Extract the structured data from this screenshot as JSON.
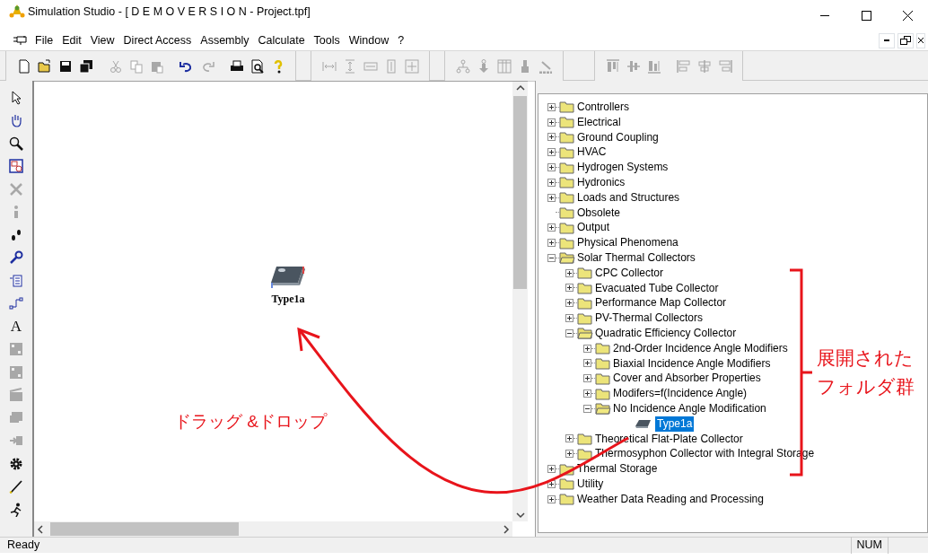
{
  "window": {
    "title": "Simulation Studio - [ D E M O V E R S I O N - Project.tpf]"
  },
  "menu": [
    "File",
    "Edit",
    "View",
    "Direct Access",
    "Assembly",
    "Calculate",
    "Tools",
    "Window",
    "?"
  ],
  "toolbar_groups": [
    [
      {
        "kind": "new",
        "disabled": false
      },
      {
        "kind": "open",
        "disabled": false
      },
      {
        "kind": "save",
        "disabled": false
      },
      {
        "kind": "save-all",
        "disabled": false
      },
      {
        "kind": "gap"
      },
      {
        "kind": "cut",
        "disabled": true
      },
      {
        "kind": "copy",
        "disabled": true
      },
      {
        "kind": "paste",
        "disabled": true
      },
      {
        "kind": "gap"
      },
      {
        "kind": "undo",
        "disabled": false
      },
      {
        "kind": "redo",
        "disabled": true
      },
      {
        "kind": "gap"
      },
      {
        "kind": "print",
        "disabled": false
      },
      {
        "kind": "preview",
        "disabled": false
      },
      {
        "kind": "help",
        "disabled": false
      }
    ],
    [
      {
        "kind": "space-h",
        "disabled": true
      },
      {
        "kind": "space-v",
        "disabled": true
      },
      {
        "kind": "width",
        "disabled": true
      },
      {
        "kind": "height",
        "disabled": true
      },
      {
        "kind": "size",
        "disabled": true
      }
    ],
    [
      {
        "kind": "tree",
        "disabled": true
      },
      {
        "kind": "down",
        "disabled": true
      },
      {
        "kind": "table",
        "disabled": true
      },
      {
        "kind": "brush",
        "disabled": true
      },
      {
        "kind": "wand",
        "disabled": true
      }
    ],
    [
      {
        "kind": "align-top",
        "disabled": true
      },
      {
        "kind": "align-middle",
        "disabled": true
      },
      {
        "kind": "align-bottom",
        "disabled": true
      },
      {
        "kind": "gap"
      },
      {
        "kind": "align-left",
        "disabled": true
      },
      {
        "kind": "align-center",
        "disabled": true
      },
      {
        "kind": "align-right",
        "disabled": true
      }
    ]
  ],
  "side_tools": [
    {
      "kind": "pointer",
      "disabled": false
    },
    {
      "kind": "hand",
      "disabled": false
    },
    {
      "kind": "zoom",
      "disabled": false
    },
    {
      "kind": "select",
      "disabled": false
    },
    {
      "kind": "delete",
      "disabled": true
    },
    {
      "kind": "info",
      "disabled": true
    },
    {
      "kind": "steps",
      "disabled": false
    },
    {
      "kind": "key",
      "disabled": false
    },
    {
      "kind": "list",
      "disabled": false
    },
    {
      "kind": "link",
      "disabled": false
    },
    {
      "kind": "text",
      "label": "A",
      "disabled": false
    },
    {
      "kind": "block",
      "disabled": true
    },
    {
      "kind": "block",
      "disabled": true
    },
    {
      "kind": "clap",
      "disabled": true
    },
    {
      "kind": "stack",
      "disabled": true
    },
    {
      "kind": "import",
      "disabled": true
    },
    {
      "kind": "gear",
      "disabled": false
    },
    {
      "kind": "pen",
      "disabled": false
    },
    {
      "kind": "run",
      "disabled": false
    }
  ],
  "canvas": {
    "components": [
      {
        "label": "Type1a"
      }
    ]
  },
  "tree": [
    {
      "label": "Controllers",
      "expandable": true,
      "expanded": false
    },
    {
      "label": "Electrical",
      "expandable": true,
      "expanded": false
    },
    {
      "label": "Ground Coupling",
      "expandable": true,
      "expanded": false
    },
    {
      "label": "HVAC",
      "expandable": true,
      "expanded": false
    },
    {
      "label": "Hydrogen Systems",
      "expandable": true,
      "expanded": false
    },
    {
      "label": "Hydronics",
      "expandable": true,
      "expanded": false
    },
    {
      "label": "Loads and Structures",
      "expandable": true,
      "expanded": false
    },
    {
      "label": "Obsolete",
      "expandable": false,
      "expanded": false
    },
    {
      "label": "Output",
      "expandable": true,
      "expanded": false
    },
    {
      "label": "Physical Phenomena",
      "expandable": true,
      "expanded": false
    },
    {
      "label": "Solar Thermal Collectors",
      "expandable": true,
      "expanded": true,
      "children": [
        {
          "label": "CPC Collector",
          "expandable": true,
          "expanded": false
        },
        {
          "label": "Evacuated Tube Collector",
          "expandable": true,
          "expanded": false
        },
        {
          "label": "Performance Map Collector",
          "expandable": true,
          "expanded": false
        },
        {
          "label": "PV-Thermal Collectors",
          "expandable": true,
          "expanded": false
        },
        {
          "label": "Quadratic Efficiency Collector",
          "expandable": true,
          "expanded": true,
          "children": [
            {
              "label": "2nd-Order Incidence Angle Modifiers",
              "expandable": true,
              "expanded": false
            },
            {
              "label": "Biaxial Incidence Angle Modifiers",
              "expandable": true,
              "expanded": false
            },
            {
              "label": "Cover and Absorber Properties",
              "expandable": true,
              "expanded": false
            },
            {
              "label": "Modifers=f(Incidence Angle)",
              "expandable": true,
              "expanded": false
            },
            {
              "label": "No Incidence Angle Modification",
              "expandable": true,
              "expanded": true,
              "children": [
                {
                  "label": "Type1a",
                  "kind": "component",
                  "selected": true
                }
              ]
            }
          ]
        },
        {
          "label": "Theoretical Flat-Plate Collector",
          "expandable": true,
          "expanded": false
        },
        {
          "label": "Thermosyphon Collector with Integral Storage",
          "expandable": true,
          "expanded": false
        }
      ]
    },
    {
      "label": "Thermal Storage",
      "expandable": true,
      "expanded": false
    },
    {
      "label": "Utility",
      "expandable": true,
      "expanded": false
    },
    {
      "label": "Weather Data Reading and Processing",
      "expandable": true,
      "expanded": false
    }
  ],
  "status_bar": {
    "text": "Ready",
    "indicators": [
      "NUM"
    ]
  },
  "annotations": {
    "bracket_label": [
      "展開された",
      "フォルダ群"
    ],
    "arrow_label": "ドラッグ &ドロップ"
  }
}
